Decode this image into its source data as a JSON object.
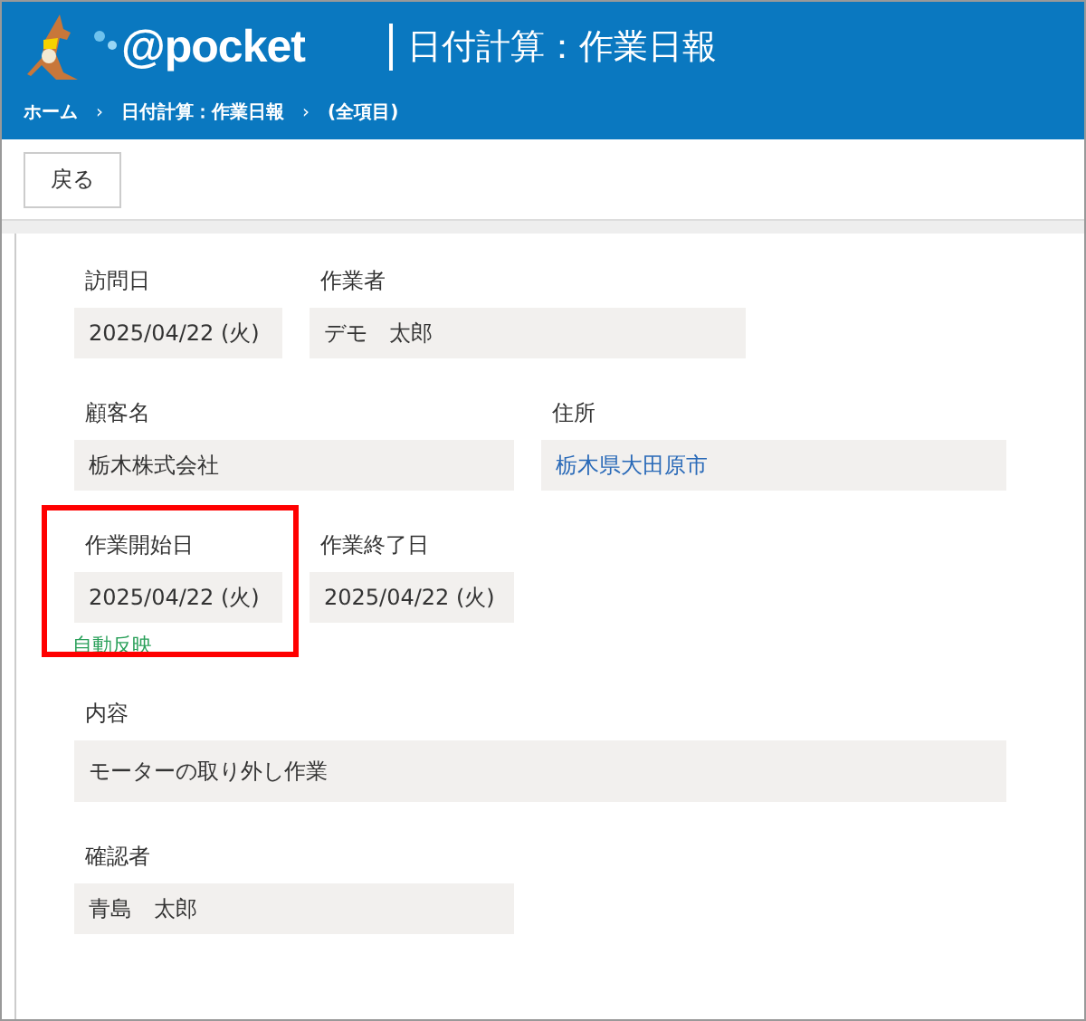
{
  "header": {
    "logo_text": "@pocket",
    "title": "日付計算：作業日報"
  },
  "breadcrumbs": [
    {
      "label": "ホーム"
    },
    {
      "label": "日付計算：作業日報"
    },
    {
      "label": "(全項目)"
    }
  ],
  "breadcrumb_separator": "›",
  "toolbar": {
    "back_button": "戻る"
  },
  "rows": [
    [
      {
        "label": "訪問日",
        "value": "2025/04/22 (火)",
        "kind": "text",
        "highlighted": false
      },
      {
        "label": "作業者",
        "value": "デモ　太郎",
        "kind": "text",
        "highlighted": false
      }
    ],
    [
      {
        "label": "顧客名",
        "value": "栃木株式会社",
        "kind": "text",
        "highlighted": false
      },
      {
        "label": "住所",
        "value": "栃木県大田原市",
        "kind": "link",
        "highlighted": false
      }
    ],
    [
      {
        "label": "作業開始日",
        "value": "2025/04/22 (火)",
        "kind": "text",
        "highlighted": true,
        "note": "自動反映"
      },
      {
        "label": "作業終了日",
        "value": "2025/04/22 (火)",
        "kind": "text",
        "highlighted": false
      }
    ],
    [
      {
        "label": "内容",
        "value": "モーターの取り外し作業",
        "kind": "text",
        "highlighted": false
      }
    ],
    [
      {
        "label": "確認者",
        "value": "青島　太郎",
        "kind": "text",
        "highlighted": false
      }
    ]
  ]
}
